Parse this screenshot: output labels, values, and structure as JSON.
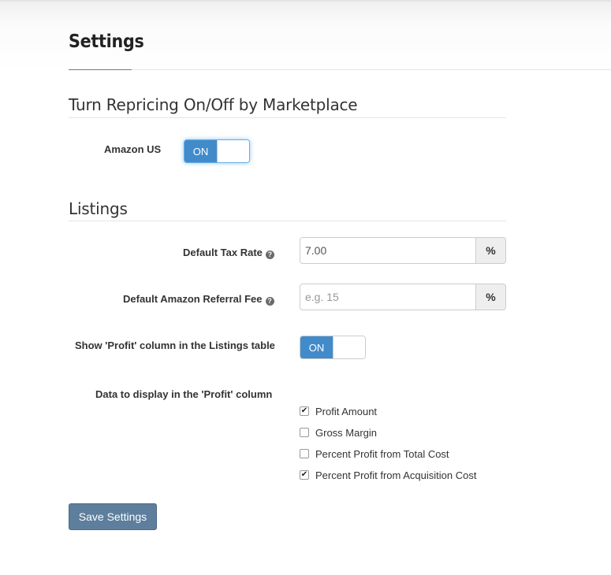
{
  "page": {
    "title": "Settings"
  },
  "repricing": {
    "heading": "Turn Repricing On/Off by Marketplace",
    "amazon_us_label": "Amazon US",
    "amazon_us_toggle": "ON"
  },
  "listings": {
    "heading": "Listings",
    "tax_rate": {
      "label": "Default Tax Rate",
      "value": "7.00",
      "unit": "%"
    },
    "referral_fee": {
      "label": "Default Amazon Referral Fee",
      "value": "",
      "placeholder": "e.g. 15",
      "unit": "%"
    },
    "profit_column": {
      "label": "Show 'Profit' column in the Listings table",
      "toggle": "ON"
    },
    "profit_data": {
      "label": "Data to display in the 'Profit' column",
      "options": [
        {
          "label": "Profit Amount",
          "checked": true
        },
        {
          "label": "Gross Margin",
          "checked": false
        },
        {
          "label": "Percent Profit from Total Cost",
          "checked": false
        },
        {
          "label": "Percent Profit from Acquisition Cost",
          "checked": true
        }
      ]
    }
  },
  "actions": {
    "save_label": "Save Settings"
  },
  "icons": {
    "help": "question-circle-icon",
    "check": "check-icon"
  },
  "colors": {
    "primary": "#428bca",
    "save_button": "#5d7e9c",
    "focus_glow": "#66afe9"
  }
}
